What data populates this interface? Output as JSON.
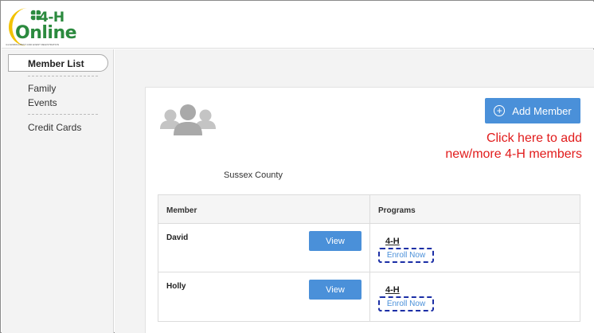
{
  "header": {
    "logo": {
      "brand_top": "4-H",
      "brand_bottom": "Online",
      "tagline": "4-H ENROLLMENT AND EVENT REGISTRATION"
    }
  },
  "sidebar": {
    "active_label": "Member List",
    "items": [
      {
        "label": "Family"
      },
      {
        "label": "Events"
      },
      {
        "label": "Credit Cards"
      }
    ]
  },
  "main": {
    "add_member_label": "Add Member",
    "annotation_line1": "Click here to add",
    "annotation_line2": "new/more 4-H members",
    "county": "Sussex County",
    "table": {
      "headers": [
        "Member",
        "Programs"
      ],
      "rows": [
        {
          "member": "David",
          "view_label": "View",
          "program": "4-H",
          "enroll_label": "Enroll Now"
        },
        {
          "member": "Holly",
          "view_label": "View",
          "program": "4-H",
          "enroll_label": "Enroll Now"
        }
      ]
    }
  },
  "colors": {
    "accent_blue": "#4a90d9",
    "annotation_red": "#e11b1b",
    "brand_green": "#2b8a3e",
    "brand_yellow": "#f2c200",
    "highlight_dash": "#1c2fa6"
  },
  "icons": [
    "clover-logo-icon",
    "people-icon",
    "plus-circle-icon"
  ]
}
